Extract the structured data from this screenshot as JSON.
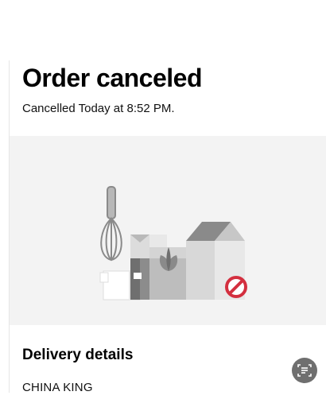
{
  "order": {
    "title": "Order canceled",
    "subtitle": "Cancelled Today at 8:52 PM."
  },
  "hero": {
    "illustration": "canceled-grocery-illustration",
    "badge_icon": "no-entry-icon",
    "badge_color": "#d32f3f"
  },
  "delivery": {
    "heading": "Delivery details",
    "restaurant": "CHINA KING"
  },
  "floating_action": {
    "icon": "text-scan-icon"
  },
  "colors": {
    "background": "#ffffff",
    "hero_background": "#f3f3f3",
    "text": "#000000"
  }
}
